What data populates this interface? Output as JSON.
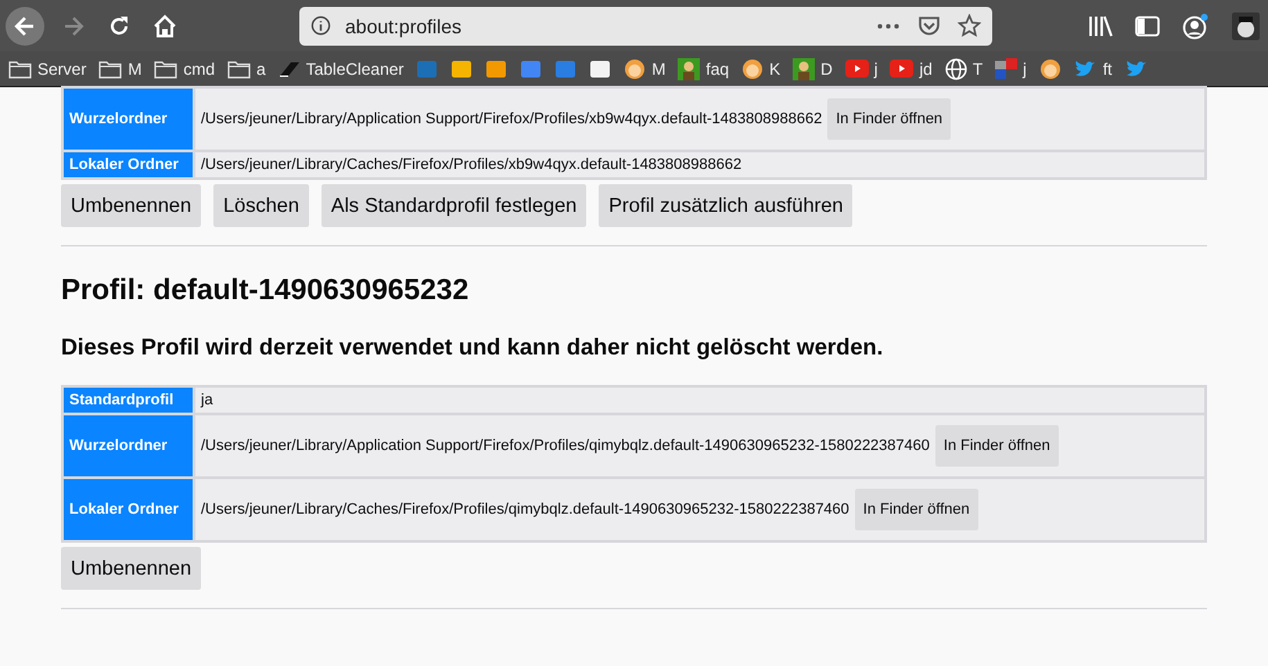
{
  "toolbar": {
    "url": "about:profiles"
  },
  "bookmarks": [
    {
      "kind": "folder",
      "label": "Server"
    },
    {
      "kind": "folder",
      "label": "M"
    },
    {
      "kind": "folder",
      "label": "cmd"
    },
    {
      "kind": "folder",
      "label": "a"
    },
    {
      "kind": "eraser",
      "label": "TableCleaner"
    },
    {
      "kind": "logo",
      "color": "#1c6fb5"
    },
    {
      "kind": "logo",
      "color": "#f4b400"
    },
    {
      "kind": "logo",
      "color": "#f29900"
    },
    {
      "kind": "logo",
      "color": "#4285f4"
    },
    {
      "kind": "logo",
      "color": "#2a7de1"
    },
    {
      "kind": "logo",
      "color": "#f3f3f3"
    },
    {
      "kind": "avatar",
      "label": "M"
    },
    {
      "kind": "figure",
      "label": "faq"
    },
    {
      "kind": "avatar",
      "label": "K"
    },
    {
      "kind": "figure",
      "label": "D"
    },
    {
      "kind": "video",
      "label": "j"
    },
    {
      "kind": "video",
      "label": "jd"
    },
    {
      "kind": "globe",
      "label": "T"
    },
    {
      "kind": "tiles",
      "label": "j"
    },
    {
      "kind": "avatar"
    },
    {
      "kind": "bird",
      "label": "ft"
    },
    {
      "kind": "bird"
    }
  ],
  "profiles": [
    {
      "rows": [
        {
          "label": "Wurzelordner",
          "value": "/Users/jeuner/Library/Application Support/Firefox/Profiles/xb9w4qyx.default-1483808988662",
          "button": "In Finder öffnen"
        },
        {
          "label": "Lokaler Ordner",
          "value": "/Users/jeuner/Library/Caches/Firefox/Profiles/xb9w4qyx.default-1483808988662"
        }
      ],
      "buttons": [
        "Umbenennen",
        "Löschen",
        "Als Standardprofil festlegen",
        "Profil zusätzlich ausführen"
      ]
    },
    {
      "title": "Profil: default-1490630965232",
      "notice": "Dieses Profil wird derzeit verwendet und kann daher nicht gelöscht werden.",
      "rows": [
        {
          "label": "Standardprofil",
          "value": "ja"
        },
        {
          "label": "Wurzelordner",
          "value": "/Users/jeuner/Library/Application Support/Firefox/Profiles/qimybqlz.default-1490630965232-1580222387460",
          "button": "In Finder öffnen"
        },
        {
          "label": "Lokaler Ordner",
          "value": "/Users/jeuner/Library/Caches/Firefox/Profiles/qimybqlz.default-1490630965232-1580222387460",
          "button": "In Finder öffnen"
        }
      ],
      "buttons": [
        "Umbenennen"
      ]
    }
  ]
}
